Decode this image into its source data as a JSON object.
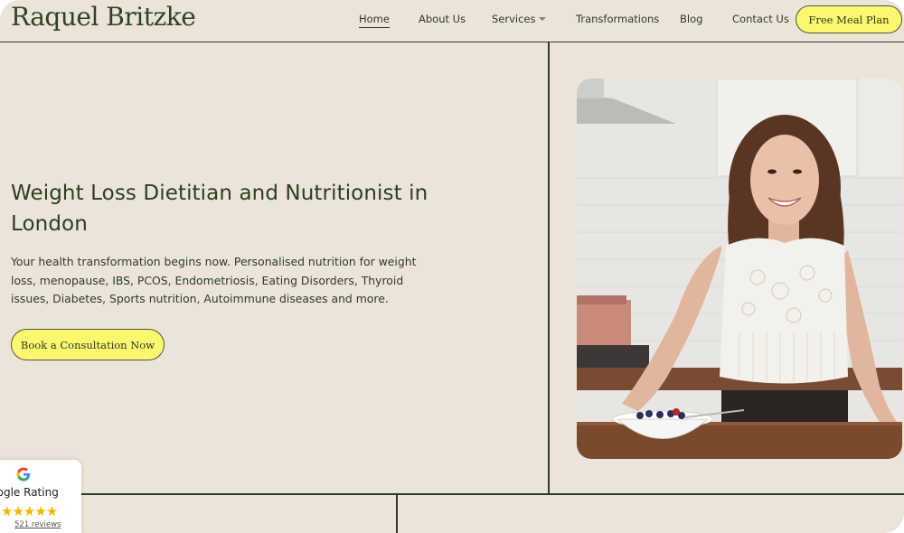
{
  "header": {
    "logo": "Raquel Britzke",
    "nav": [
      {
        "label": "Home",
        "active": true
      },
      {
        "label": "About Us"
      },
      {
        "label": "Services",
        "has_dropdown": true
      },
      {
        "label": "Transformations"
      },
      {
        "label": "Blog"
      },
      {
        "label": "Contact Us"
      }
    ],
    "cta_label": "Free Meal Plan"
  },
  "hero": {
    "title": "Weight Loss Dietitian and Nutritionist in London",
    "subtitle": "Your health transformation begins now. Personalised nutrition for weight loss, menopause, IBS, PCOS, Endometriosis, Eating Disorders, Thyroid issues, Diabetes, Sports nutrition, Autoimmune diseases and more.",
    "button_label": "Book a Consultation Now",
    "image_alt": "Smiling dietitian in a kitchen holding a bowl of berries"
  },
  "rating_widget": {
    "icon": "google-icon",
    "label": "Google Rating",
    "stars": 5,
    "stars_text": "★★★★★",
    "reviews_text": "521 reviews"
  },
  "colors": {
    "background": "#ece4d9",
    "accent_yellow": "#fbf870",
    "text_green": "#29401f",
    "star_gold": "#f5b400"
  }
}
